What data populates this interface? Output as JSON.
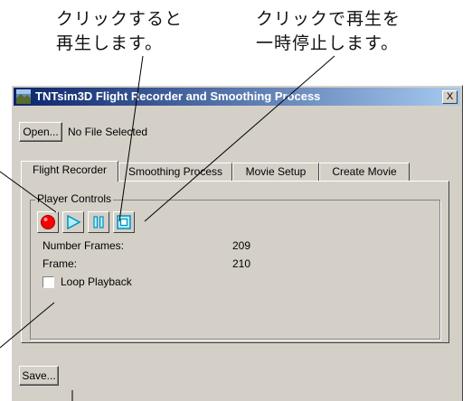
{
  "callouts": {
    "record": {
      "line1": "クリックすると",
      "line2": "再生します。"
    },
    "pause": {
      "line1": "クリックで再生を",
      "line2": "一時停止します。"
    }
  },
  "window": {
    "title": "TNTsim3D Flight Recorder and Smoothing Process",
    "close": "X"
  },
  "file": {
    "open_label": "Open...",
    "status": "No File Selected"
  },
  "tabs": [
    "Flight Recorder",
    "Smoothing Process",
    "Movie Setup",
    "Create Movie"
  ],
  "player": {
    "group_label": "Player Controls",
    "number_frames_label": "Number Frames:",
    "number_frames_value": "209",
    "frame_label": "Frame:",
    "frame_value": "210",
    "loop_label": "Loop Playback",
    "loop_checked": false
  },
  "save_label": "Save...",
  "icons": {
    "record": "record-icon",
    "play": "play-icon",
    "pause": "pause-icon",
    "stop": "stop-icon"
  },
  "colors": {
    "record": "#ff0000",
    "play": "#00a0c8",
    "titlebar": "#0a246a"
  }
}
